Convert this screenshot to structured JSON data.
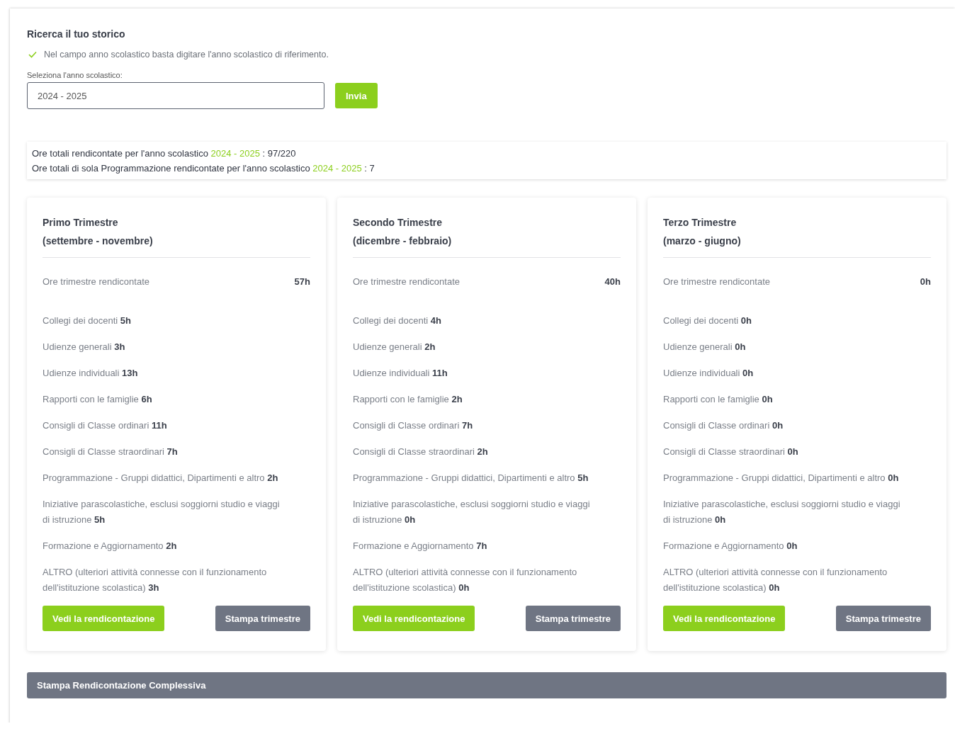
{
  "search": {
    "title": "Ricerca il tuo storico",
    "hint": "Nel campo anno scolastico basta digitare l'anno scolastico di riferimento.",
    "field_label": "Seleziona l'anno scolastico:",
    "value": "2024 - 2025",
    "button": "Invia"
  },
  "summary": [
    {
      "text": "Ore totali rendicontate per l'anno scolastico",
      "year": "2024 - 2025",
      "value": ": 97/220"
    },
    {
      "text": "Ore totali di sola Programmazione rendicontate per l'anno scolastico",
      "year": "2024 - 2025",
      "value": ": 7"
    }
  ],
  "trimesters": [
    {
      "title": "Primo Trimestre",
      "period": "(settembre - novembre)",
      "total_label": "Ore trimestre rendicontate",
      "total": "57h",
      "items": [
        {
          "label": "Collegi dei docenti",
          "value": "5h"
        },
        {
          "label": "Udienze generali",
          "value": "3h"
        },
        {
          "label": "Udienze individuali",
          "value": "13h"
        },
        {
          "label": "Rapporti con le famiglie",
          "value": "6h"
        },
        {
          "label": "Consigli di Classe ordinari",
          "value": "11h"
        },
        {
          "label": "Consigli di Classe straordinari",
          "value": "7h"
        },
        {
          "label": "Programmazione - Gruppi didattici, Dipartimenti e altro",
          "value": "2h"
        },
        {
          "label": "Iniziative parascolastiche, esclusi soggiorni studio e viaggi di istruzione",
          "value": "5h"
        },
        {
          "label": "Formazione e Aggiornamento",
          "value": "2h"
        },
        {
          "label": "ALTRO (ulteriori attività connesse con il funzionamento dell'istituzione scolastica)",
          "value": "3h"
        }
      ],
      "buttons": [
        "Vedi la rendicontazione",
        "Stampa trimestre"
      ]
    },
    {
      "title": "Secondo Trimestre",
      "period": "(dicembre - febbraio)",
      "total_label": "Ore trimestre rendicontate",
      "total": "40h",
      "items": [
        {
          "label": "Collegi dei docenti",
          "value": "4h"
        },
        {
          "label": "Udienze generali",
          "value": "2h"
        },
        {
          "label": "Udienze individuali",
          "value": "11h"
        },
        {
          "label": "Rapporti con le famiglie",
          "value": "2h"
        },
        {
          "label": "Consigli di Classe ordinari",
          "value": "7h"
        },
        {
          "label": "Consigli di Classe straordinari",
          "value": "2h"
        },
        {
          "label": "Programmazione - Gruppi didattici, Dipartimenti e altro",
          "value": "5h"
        },
        {
          "label": "Iniziative parascolastiche, esclusi soggiorni studio e viaggi di istruzione",
          "value": "0h"
        },
        {
          "label": "Formazione e Aggiornamento",
          "value": "7h"
        },
        {
          "label": "ALTRO (ulteriori attività connesse con il funzionamento dell'istituzione scolastica)",
          "value": "0h"
        }
      ],
      "buttons": [
        "Vedi la rendicontazione",
        "Stampa trimestre"
      ]
    },
    {
      "title": "Terzo Trimestre",
      "period": "(marzo - giugno)",
      "total_label": "Ore trimestre rendicontate",
      "total": "0h",
      "items": [
        {
          "label": "Collegi dei docenti",
          "value": "0h"
        },
        {
          "label": "Udienze generali",
          "value": "0h"
        },
        {
          "label": "Udienze individuali",
          "value": "0h"
        },
        {
          "label": "Rapporti con le famiglie",
          "value": "0h"
        },
        {
          "label": "Consigli di Classe ordinari",
          "value": "0h"
        },
        {
          "label": "Consigli di Classe straordinari",
          "value": "0h"
        },
        {
          "label": "Programmazione - Gruppi didattici, Dipartimenti e altro",
          "value": "0h"
        },
        {
          "label": "Iniziative parascolastiche, esclusi soggiorni studio e viaggi di istruzione",
          "value": "0h"
        },
        {
          "label": "Formazione e Aggiornamento",
          "value": "0h"
        },
        {
          "label": "ALTRO (ulteriori attività connesse con il funzionamento dell'istituzione scolastica)",
          "value": "0h"
        }
      ],
      "buttons": [
        "Vedi la rendicontazione",
        "Stampa trimestre"
      ]
    }
  ],
  "print_all": "Stampa Rendicontazione Complessiva"
}
